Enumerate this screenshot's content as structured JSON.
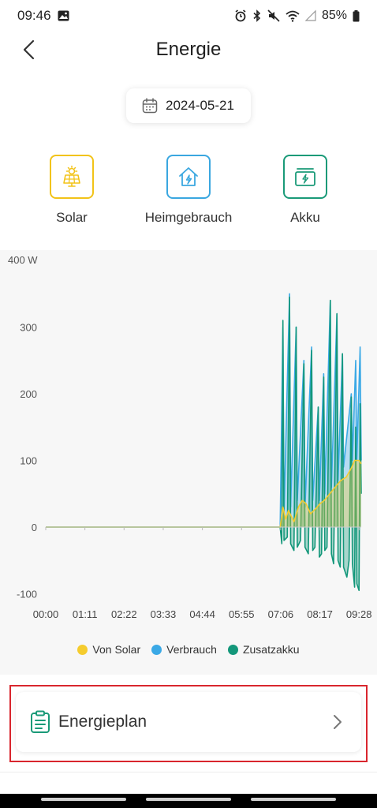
{
  "status": {
    "time": "09:46",
    "battery": "85%"
  },
  "header": {
    "title": "Energie",
    "back_icon": "chevron-left-icon"
  },
  "date": {
    "value": "2024-05-21",
    "icon": "calendar-icon"
  },
  "categories": [
    {
      "label": "Solar",
      "icon": "solar-panel-icon",
      "color": "#f2c318"
    },
    {
      "label": "Heimgebrauch",
      "icon": "home-icon",
      "color": "#3aa7e0"
    },
    {
      "label": "Akku",
      "icon": "battery-icon",
      "color": "#1a9a78"
    }
  ],
  "chart_data": {
    "type": "line",
    "unit_label": "400 W",
    "ylim": [
      -100,
      400
    ],
    "y_ticks": [
      "300",
      "200",
      "100",
      "0",
      "-100"
    ],
    "x_ticks": [
      "00:00",
      "01:11",
      "02:22",
      "03:33",
      "04:44",
      "05:55",
      "07:06",
      "08:17",
      "09:28"
    ],
    "grid": false,
    "legend_position": "bottom-center",
    "series": [
      {
        "name": "Von Solar",
        "color": "#f5cc2e",
        "points": [
          [
            "00:00",
            0
          ],
          [
            "07:05",
            0
          ],
          [
            "07:10",
            30
          ],
          [
            "07:15",
            12
          ],
          [
            "07:20",
            25
          ],
          [
            "07:30",
            8
          ],
          [
            "07:38",
            30
          ],
          [
            "07:45",
            40
          ],
          [
            "07:52",
            35
          ],
          [
            "08:00",
            20
          ],
          [
            "08:10",
            28
          ],
          [
            "08:17",
            35
          ],
          [
            "08:25",
            40
          ],
          [
            "08:35",
            50
          ],
          [
            "08:45",
            60
          ],
          [
            "08:55",
            70
          ],
          [
            "09:05",
            75
          ],
          [
            "09:15",
            90
          ],
          [
            "09:20",
            100
          ],
          [
            "09:28",
            100
          ],
          [
            "09:32",
            95
          ]
        ]
      },
      {
        "name": "Verbrauch",
        "color": "#3ba9e6",
        "points": [
          [
            "00:00",
            0
          ],
          [
            "07:05",
            0
          ],
          [
            "07:10",
            300
          ],
          [
            "07:12",
            20
          ],
          [
            "07:22",
            350
          ],
          [
            "07:24",
            30
          ],
          [
            "07:34",
            300
          ],
          [
            "07:36",
            40
          ],
          [
            "07:48",
            250
          ],
          [
            "07:50",
            30
          ],
          [
            "08:02",
            270
          ],
          [
            "08:04",
            40
          ],
          [
            "08:14",
            180
          ],
          [
            "08:16",
            40
          ],
          [
            "08:24",
            230
          ],
          [
            "08:26",
            50
          ],
          [
            "08:36",
            340
          ],
          [
            "08:38",
            60
          ],
          [
            "08:48",
            320
          ],
          [
            "08:50",
            70
          ],
          [
            "08:58",
            260
          ],
          [
            "09:00",
            90
          ],
          [
            "09:14",
            200
          ],
          [
            "09:16",
            100
          ],
          [
            "09:22",
            250
          ],
          [
            "09:24",
            100
          ],
          [
            "09:30",
            270
          ],
          [
            "09:32",
            100
          ]
        ]
      },
      {
        "name": "Zusatzakku",
        "color": "#13977a",
        "points": [
          [
            "00:00",
            0
          ],
          [
            "07:05",
            0
          ],
          [
            "07:08",
            -25
          ],
          [
            "07:10",
            310
          ],
          [
            "07:12",
            -20
          ],
          [
            "07:18",
            -15
          ],
          [
            "07:22",
            345
          ],
          [
            "07:24",
            -25
          ],
          [
            "07:30",
            -35
          ],
          [
            "07:34",
            300
          ],
          [
            "07:36",
            -30
          ],
          [
            "07:42",
            -20
          ],
          [
            "07:48",
            245
          ],
          [
            "07:50",
            -30
          ],
          [
            "07:56",
            -40
          ],
          [
            "08:02",
            265
          ],
          [
            "08:04",
            -35
          ],
          [
            "08:08",
            -30
          ],
          [
            "08:14",
            180
          ],
          [
            "08:16",
            -45
          ],
          [
            "08:20",
            -40
          ],
          [
            "08:24",
            225
          ],
          [
            "08:26",
            -35
          ],
          [
            "08:30",
            -30
          ],
          [
            "08:36",
            340
          ],
          [
            "08:38",
            -40
          ],
          [
            "08:42",
            -55
          ],
          [
            "08:48",
            320
          ],
          [
            "08:50",
            -50
          ],
          [
            "08:54",
            -60
          ],
          [
            "08:58",
            260
          ],
          [
            "09:00",
            -60
          ],
          [
            "09:06",
            -75
          ],
          [
            "09:10",
            -50
          ],
          [
            "09:14",
            195
          ],
          [
            "09:16",
            -55
          ],
          [
            "09:20",
            -90
          ],
          [
            "09:22",
            150
          ],
          [
            "09:24",
            -85
          ],
          [
            "09:28",
            -95
          ],
          [
            "09:30",
            185
          ],
          [
            "09:32",
            50
          ]
        ]
      }
    ]
  },
  "plan": {
    "label": "Energieplan",
    "icon": "clipboard-icon",
    "chevron_icon": "chevron-right-icon"
  }
}
